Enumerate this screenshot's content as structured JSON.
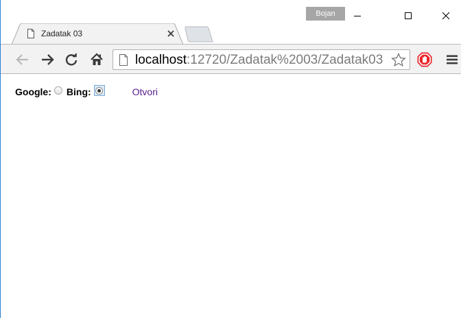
{
  "window": {
    "user_badge": "Bojan",
    "colors": {
      "frame_border": "#2b7fd3",
      "badge": "#a6a6a6"
    }
  },
  "tabs": [
    {
      "title": "Zadatak 03",
      "icon": "page-icon",
      "active": true
    }
  ],
  "toolbar": {
    "url_host": "localhost",
    "url_path": ":12720/Zadatak%2003/Zadatak03",
    "icons": [
      "back-arrow-icon",
      "forward-arrow-icon",
      "reload-icon",
      "home-icon",
      "page-icon",
      "star-icon",
      "stop-sign-icon",
      "hamburger-menu-icon"
    ]
  },
  "page": {
    "google_label": "Google:",
    "bing_label": "Bing:",
    "selected": "bing",
    "link_text": "Otvori",
    "colors": {
      "link": "#551a8b"
    }
  }
}
